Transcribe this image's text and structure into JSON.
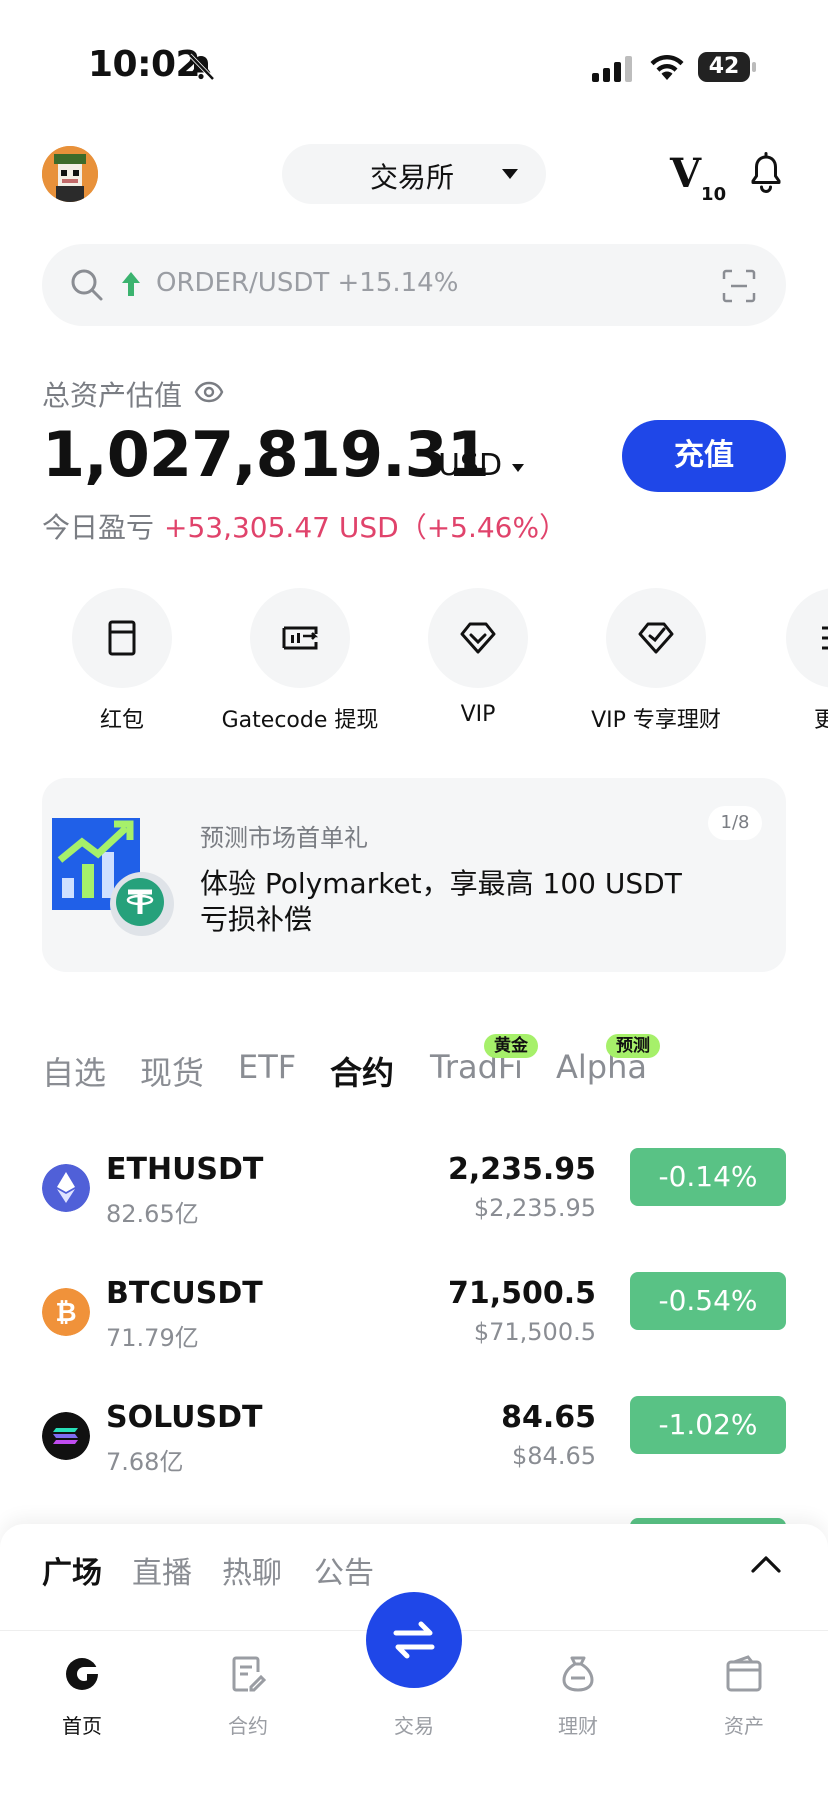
{
  "status_bar": {
    "time": "10:02",
    "battery": "42"
  },
  "header": {
    "exchange_label": "交易所",
    "vip_level": "V",
    "vip_level_num": "10"
  },
  "search": {
    "trending_text": "ORDER/USDT +15.14%",
    "trending_color": "#3bb36f"
  },
  "balance": {
    "label": "总资产估值",
    "value": "1,027,819.31",
    "currency": "USD",
    "deposit_label": "充值",
    "pnl_label": "今日盈亏",
    "pnl_value": "+53,305.47 USD（+5.46%）"
  },
  "quick_actions": [
    {
      "label": "红包",
      "icon": "red-packet-icon"
    },
    {
      "label": "Gatecode 提现",
      "icon": "gatecode-icon"
    },
    {
      "label": "VIP",
      "icon": "vip-diamond-icon"
    },
    {
      "label": "VIP 专享理财",
      "icon": "vip-finance-icon"
    },
    {
      "label": "更",
      "icon": "more-icon"
    }
  ],
  "banner": {
    "subtitle": "预测市场首单礼",
    "title": "体验 Polymarket，享最高 100 USDT 亏损补偿",
    "pager": "1/8"
  },
  "market_tabs": [
    {
      "label": "自选",
      "active": false
    },
    {
      "label": "现货",
      "active": false
    },
    {
      "label": "ETF",
      "active": false
    },
    {
      "label": "合约",
      "active": true
    },
    {
      "label": "TradFi",
      "active": false,
      "badge": "黄金"
    },
    {
      "label": "Alpha",
      "active": false,
      "badge": "预测"
    }
  ],
  "tickers": [
    {
      "symbol": "ETHUSDT",
      "volume": "82.65亿",
      "price": "2,235.95",
      "usd_price": "$2,235.95",
      "change": "-0.14%",
      "icon": "eth-icon"
    },
    {
      "symbol": "BTCUSDT",
      "volume": "71.79亿",
      "price": "71,500.5",
      "usd_price": "$71,500.5",
      "change": "-0.54%",
      "icon": "btc-icon"
    },
    {
      "symbol": "SOLUSDT",
      "volume": "7.68亿",
      "price": "84.65",
      "usd_price": "$84.65",
      "change": "-1.02%",
      "icon": "sol-icon"
    }
  ],
  "sheet_tabs": [
    {
      "label": "广场",
      "active": true
    },
    {
      "label": "直播",
      "active": false
    },
    {
      "label": "热聊",
      "active": false
    },
    {
      "label": "公告",
      "active": false
    }
  ],
  "bottom_nav": [
    {
      "label": "首页",
      "icon": "home-icon",
      "active": true
    },
    {
      "label": "合约",
      "icon": "futures-icon",
      "active": false
    },
    {
      "label": "交易",
      "icon": "trade-swap-icon",
      "active": false
    },
    {
      "label": "理财",
      "icon": "earn-icon",
      "active": false
    },
    {
      "label": "资产",
      "icon": "wallet-icon",
      "active": false
    }
  ],
  "colors": {
    "brand_blue": "#1f47e8",
    "pnl_red": "#e0436b",
    "down_green": "#59c285",
    "badge_lime": "#a6f06a"
  }
}
